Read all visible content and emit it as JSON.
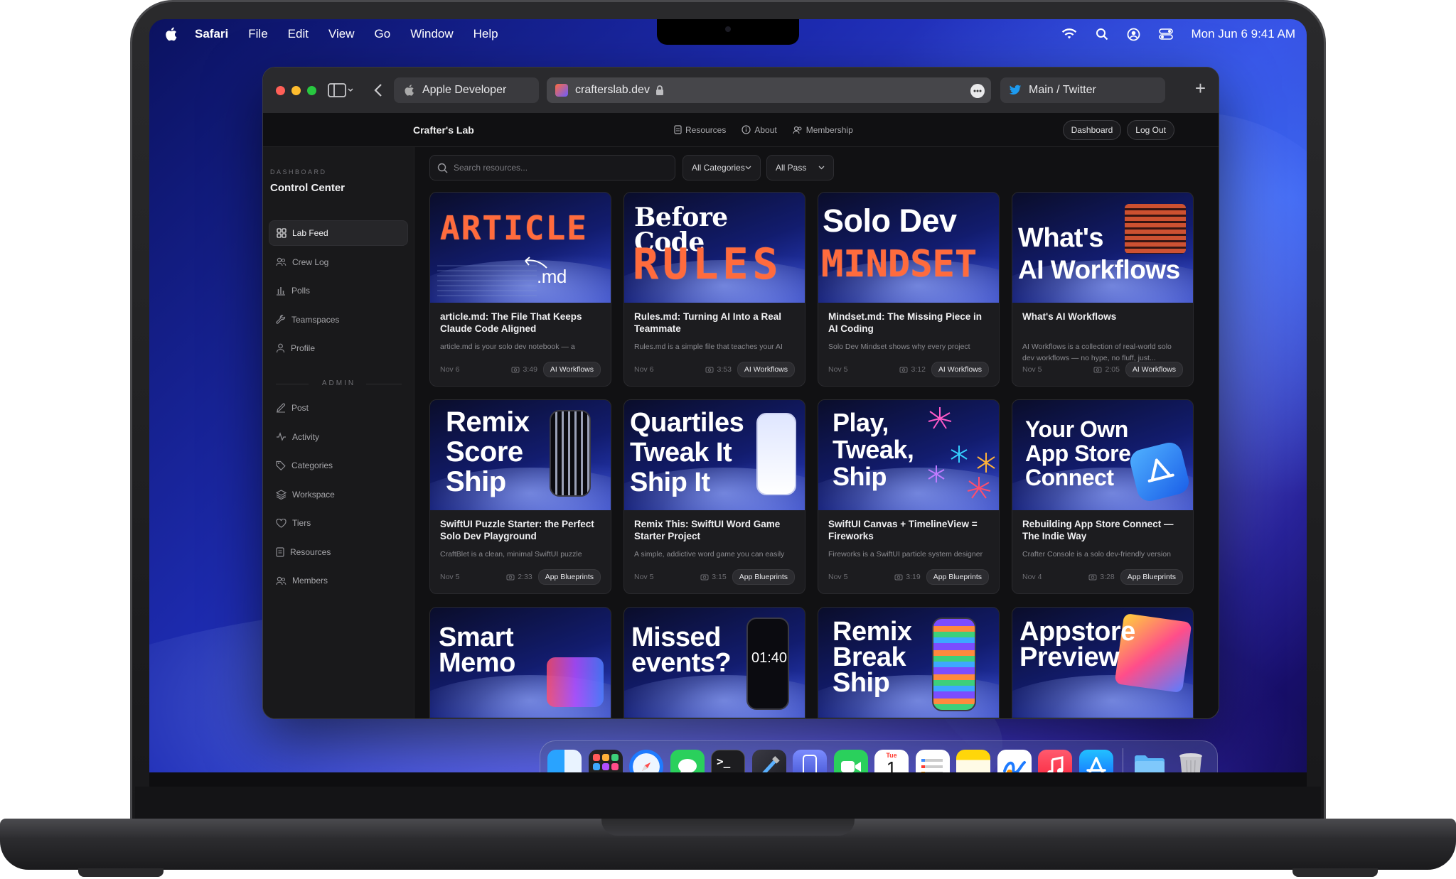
{
  "menubar": {
    "app": "Safari",
    "items": [
      "File",
      "Edit",
      "View",
      "Go",
      "Window",
      "Help"
    ],
    "clock": "Mon Jun 6  9:41 AM"
  },
  "safari": {
    "tabs": [
      {
        "label": "Apple Developer"
      },
      {
        "label": "crafterslab.dev"
      },
      {
        "label": "Main / Twitter"
      }
    ],
    "new_tab": "+"
  },
  "site": {
    "brand": "Crafter's Lab",
    "nav": [
      "Resources",
      "About",
      "Membership"
    ],
    "buttons": {
      "dashboard": "Dashboard",
      "logout": "Log Out"
    }
  },
  "sidebar": {
    "kicker": "DASHBOARD",
    "title": "Control Center",
    "items": [
      {
        "label": "Lab Feed",
        "icon": "grid-icon"
      },
      {
        "label": "Crew Log",
        "icon": "people-icon"
      },
      {
        "label": "Polls",
        "icon": "bar-chart-icon"
      },
      {
        "label": "Teamspaces",
        "icon": "wrench-icon"
      },
      {
        "label": "Profile",
        "icon": "person-icon"
      }
    ],
    "admin_label": "ADMIN",
    "admin_items": [
      {
        "label": "Post",
        "icon": "pencil-icon"
      },
      {
        "label": "Activity",
        "icon": "pulse-icon"
      },
      {
        "label": "Categories",
        "icon": "tag-icon"
      },
      {
        "label": "Workspace",
        "icon": "layers-icon"
      },
      {
        "label": "Tiers",
        "icon": "heart-icon"
      },
      {
        "label": "Resources",
        "icon": "document-icon"
      },
      {
        "label": "Members",
        "icon": "people-icon"
      }
    ]
  },
  "filters": {
    "search_placeholder": "Search resources...",
    "category": "All Categories",
    "pass": "All Pass"
  },
  "cards": [
    {
      "art": [
        "ARTICLE",
        ".md"
      ],
      "title": "article.md: The File That Keeps Claude Code Aligned",
      "desc": "article.md is your solo dev notebook — a",
      "date": "Nov 6",
      "duration": "3:49",
      "tag": "AI Workflows"
    },
    {
      "art": [
        "Before Code",
        "RULES"
      ],
      "title": "Rules.md: Turning AI Into a Real Teammate",
      "desc": "Rules.md is a simple file that teaches your AI",
      "date": "Nov 6",
      "duration": "3:53",
      "tag": "AI Workflows"
    },
    {
      "art": [
        "Solo Dev",
        "MINDSET"
      ],
      "title": "Mindset.md: The Missing Piece in AI Coding",
      "desc": "Solo Dev Mindset shows why every project",
      "date": "Nov 5",
      "duration": "3:12",
      "tag": "AI Workflows"
    },
    {
      "art": [
        "What's",
        "AI Workflows"
      ],
      "title": "What's AI Workflows",
      "desc": "AI Workflows is a collection of real-world solo dev workflows — no hype, no fluff, just...",
      "date": "Nov 5",
      "duration": "2:05",
      "tag": "AI Workflows"
    },
    {
      "art": [
        "Remix",
        "Score",
        "Ship"
      ],
      "title": "SwiftUI Puzzle Starter: the Perfect Solo Dev Playground",
      "desc": "CraftBlet is a clean, minimal SwiftUI puzzle",
      "date": "Nov 5",
      "duration": "2:33",
      "tag": "App Blueprints"
    },
    {
      "art": [
        "Quartiles",
        "Tweak It",
        "Ship It"
      ],
      "title": "Remix This: SwiftUI Word Game Starter Project",
      "desc": "A simple, addictive word game you can easily",
      "date": "Nov 5",
      "duration": "3:15",
      "tag": "App Blueprints"
    },
    {
      "art": [
        "Play,",
        "Tweak,",
        "Ship"
      ],
      "title": "SwiftUI Canvas + TimelineView = Fireworks",
      "desc": "Fireworks is a SwiftUI particle system designer",
      "date": "Nov 5",
      "duration": "3:19",
      "tag": "App Blueprints"
    },
    {
      "art": [
        "Your Own",
        "App Store",
        "Connect"
      ],
      "title": "Rebuilding App Store Connect — The Indie Way",
      "desc": "Crafter Console is a solo dev-friendly version",
      "date": "Nov 4",
      "duration": "3:28",
      "tag": "App Blueprints"
    },
    {
      "art": [
        "Smart",
        "Memo"
      ],
      "title": "",
      "desc": "",
      "date": "",
      "duration": "",
      "tag": ""
    },
    {
      "art": [
        "Missed",
        "events?",
        "01:40"
      ],
      "title": "",
      "desc": "",
      "date": "",
      "duration": "",
      "tag": ""
    },
    {
      "art": [
        "Remix",
        "Break",
        "Ship"
      ],
      "title": "",
      "desc": "",
      "date": "",
      "duration": "",
      "tag": ""
    },
    {
      "art": [
        "Appstore",
        "Preview"
      ],
      "title": "",
      "desc": "",
      "date": "",
      "duration": "",
      "tag": ""
    }
  ],
  "dock": {
    "apps": [
      "finder-icon",
      "launchpad-icon",
      "safari-icon",
      "messages-icon",
      "terminal-icon",
      "xcode-icon",
      "simulator-icon",
      "facetime-icon",
      "calendar-icon",
      "reminders-icon",
      "notes-icon",
      "freeform-icon",
      "music-icon",
      "appstore-icon",
      "folder-icon",
      "trash-icon"
    ],
    "calendar_day": "1",
    "calendar_month": "Tue"
  }
}
